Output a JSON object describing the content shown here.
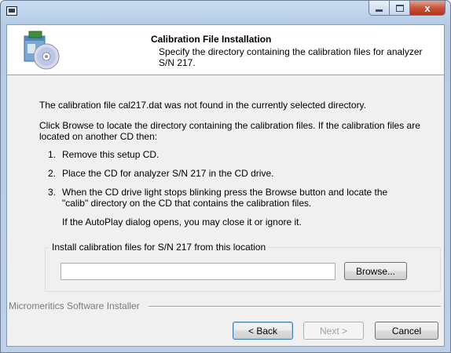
{
  "window": {
    "title": "",
    "close_glyph": "x"
  },
  "header": {
    "title": "Calibration File Installation",
    "subtitle": "Specify the directory containing the calibration files for analyzer S/N 217."
  },
  "body": {
    "not_found_text": "The calibration file cal217.dat was not found in the currently selected directory.",
    "instructions_text": "Click Browse to locate the directory containing the calibration files. If the calibration files are located on another CD then:",
    "steps": [
      {
        "num": "1.",
        "text": "Remove this setup CD."
      },
      {
        "num": "2.",
        "text": "Place the CD for analyzer S/N 217 in the CD drive."
      },
      {
        "num": "3.",
        "text": "When the CD drive light stops blinking press the Browse button and locate the \"calib\" directory on the CD that contains the calibration files."
      }
    ],
    "autoplay_note": "If the AutoPlay dialog opens, you may close it or ignore it."
  },
  "location_group": {
    "label": "Install calibration files for S/N 217 from this location",
    "path_value": "",
    "browse_label": "Browse..."
  },
  "footer": {
    "installer_label": "Micromeritics Software Installer",
    "back_label": "< Back",
    "next_label": "Next >",
    "cancel_label": "Cancel"
  }
}
